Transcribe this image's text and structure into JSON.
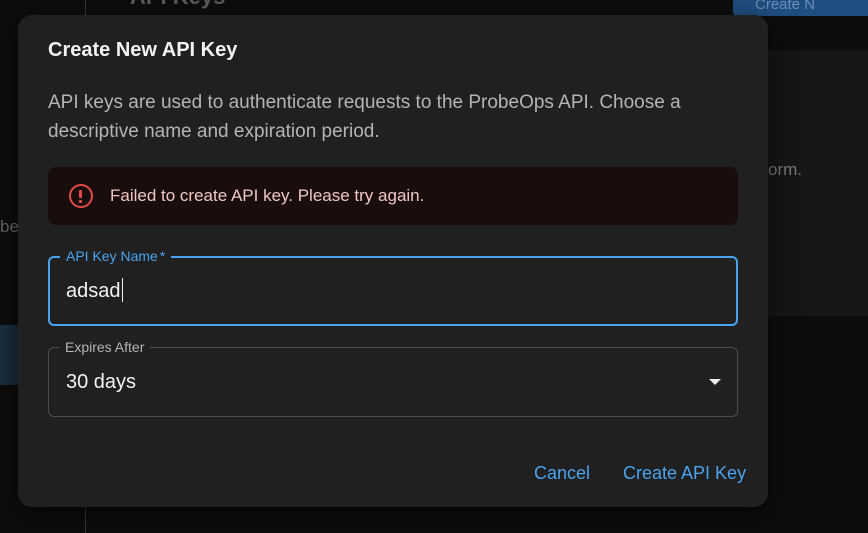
{
  "background": {
    "page_title": "API Keys",
    "create_button_label": "Create N",
    "card_text": "orm.",
    "left_text": "be"
  },
  "dialog": {
    "title": "Create New API Key",
    "description": "API keys are used to authenticate requests to the ProbeOps API. Choose a descriptive name and expiration period.",
    "error": {
      "icon": "error-circle-icon",
      "message": "Failed to create API key. Please try again.",
      "color": "#e44b47"
    },
    "name_field": {
      "label": "API Key Name",
      "required_marker": "*",
      "value": "adsad"
    },
    "expires_field": {
      "label": "Expires After",
      "selected": "30 days"
    },
    "actions": {
      "cancel": "Cancel",
      "create": "Create API Key"
    }
  },
  "colors": {
    "accent": "#4aa3ee",
    "dialog_bg": "#202020",
    "error_bg": "#190d0d"
  }
}
